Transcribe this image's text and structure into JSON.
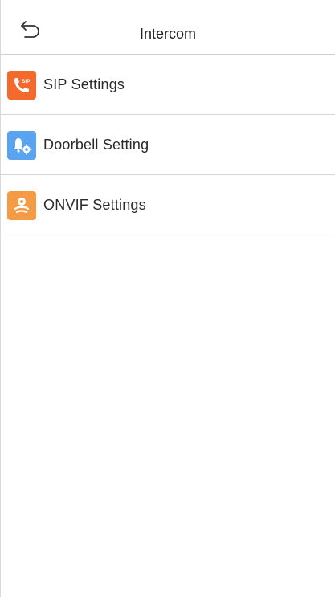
{
  "header": {
    "title": "Intercom"
  },
  "menu": [
    {
      "label": "SIP Settings",
      "icon": "sip-phone-icon",
      "icon_color": "#f46a2c",
      "icon_badge": "SIP"
    },
    {
      "label": "Doorbell Setting",
      "icon": "doorbell-gear-icon",
      "icon_color": "#5aa3f0"
    },
    {
      "label": "ONVIF Settings",
      "icon": "onvif-icon",
      "icon_color": "#f59a45"
    }
  ]
}
